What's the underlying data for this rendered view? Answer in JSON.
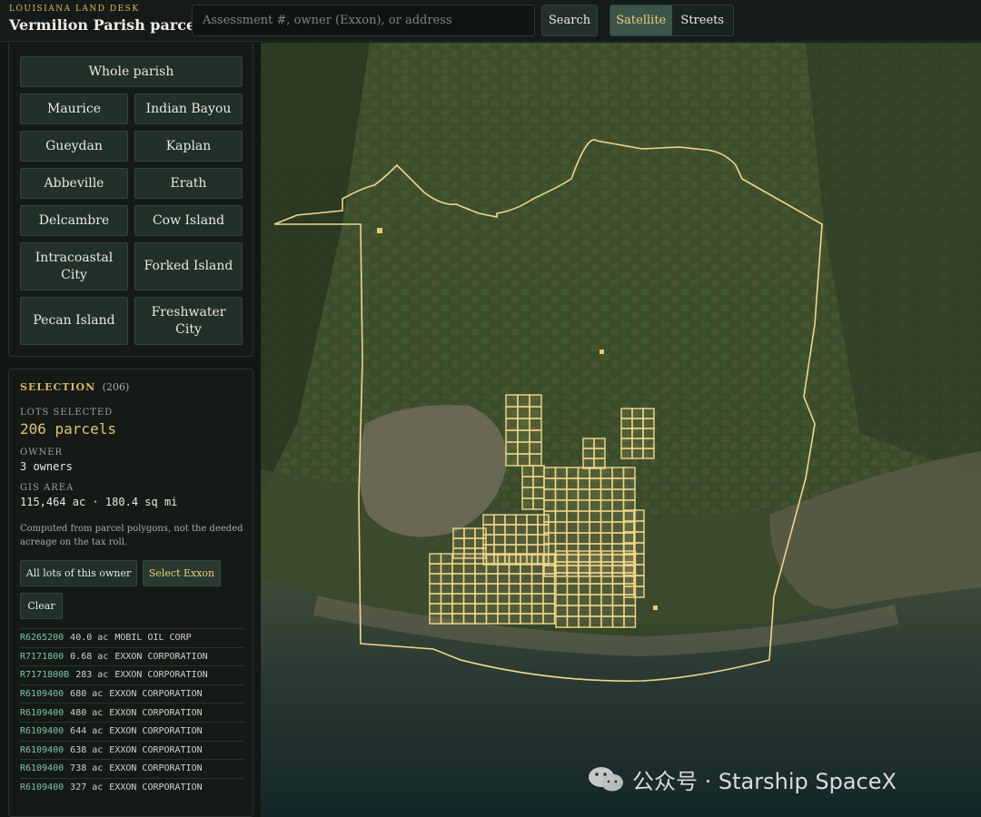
{
  "header": {
    "kicker": "LOUISIANA LAND DESK",
    "title": "Vermilion Parish parcels",
    "search_placeholder": "Assessment #, owner (Exxon), or address",
    "search_label": "Search",
    "layers": [
      {
        "label": "Satellite",
        "active": true
      },
      {
        "label": "Streets",
        "active": false
      }
    ]
  },
  "areas": {
    "whole": "Whole parish",
    "places": [
      "Maurice",
      "Indian Bayou",
      "Gueydan",
      "Kaplan",
      "Abbeville",
      "Erath",
      "Delcambre",
      "Cow Island",
      "Intracoastal City",
      "Forked Island",
      "Pecan Island",
      "Freshwater City"
    ]
  },
  "selection": {
    "heading": "SELECTION",
    "count": "(206)",
    "lots_label": "LOTS SELECTED",
    "lots_value": "206 parcels",
    "owner_label": "OWNER",
    "owner_value": "3 owners",
    "area_label": "GIS AREA",
    "area_value": "115,464 ac · 180.4 sq mi",
    "note": "Computed from parcel polygons, not the deeded acreage on the tax roll.",
    "buttons": {
      "all_lots": "All lots of this owner",
      "select_exxon": "Select Exxon",
      "clear": "Clear"
    },
    "parcels": [
      {
        "id": "R6265200",
        "acres": "40.0 ac",
        "owner": "MOBIL OIL CORP"
      },
      {
        "id": "R7171800",
        "acres": "0.68 ac",
        "owner": "EXXON CORPORATION"
      },
      {
        "id": "R7171800B",
        "acres": "283 ac",
        "owner": "EXXON CORPORATION"
      },
      {
        "id": "R6109400",
        "acres": "680 ac",
        "owner": "EXXON CORPORATION"
      },
      {
        "id": "R6109400",
        "acres": "480 ac",
        "owner": "EXXON CORPORATION"
      },
      {
        "id": "R6109400",
        "acres": "644 ac",
        "owner": "EXXON CORPORATION"
      },
      {
        "id": "R6109400",
        "acres": "638 ac",
        "owner": "EXXON CORPORATION"
      },
      {
        "id": "R6109400",
        "acres": "738 ac",
        "owner": "EXXON CORPORATION"
      },
      {
        "id": "R6109400",
        "acres": "327 ac",
        "owner": "EXXON CORPORATION"
      }
    ]
  },
  "map": {
    "boundary_color": "#f0d68a",
    "parcel_color": "#f0d68a"
  },
  "watermark": "公众号 · Starship SpaceX"
}
